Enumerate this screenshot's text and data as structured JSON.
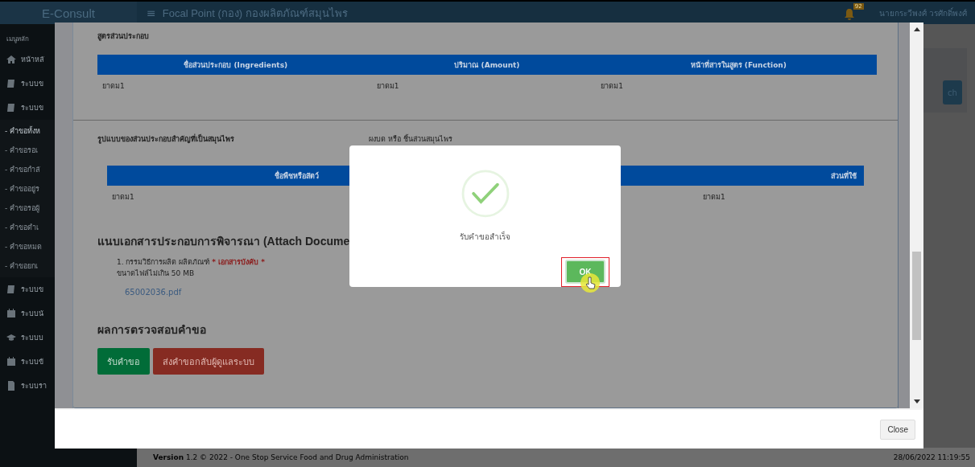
{
  "header": {
    "logo": "E-Consult",
    "menu_icon": "≡",
    "title": "Focal Point (กอง) กองผลิตภัณฑ์สมุนไพร",
    "notification_count": "92",
    "user": "นายกระวีพงศ์ วรศักดิ์พงศ์"
  },
  "sidebar": {
    "heading": "เมนูหลัก",
    "items": [
      {
        "label": "หน้าหลั"
      },
      {
        "label": "ระบบข"
      },
      {
        "label": "ระบบข",
        "children": [
          {
            "label": "- คำขอทั้งห",
            "selected": true
          },
          {
            "label": "- คำขอรอเ",
            "selected": false
          },
          {
            "label": "- คำขอกำลั",
            "selected": false
          },
          {
            "label": "- คำขออยู่ร",
            "selected": false
          },
          {
            "label": "- คำขอรอผู้",
            "selected": false
          },
          {
            "label": "- คำขอดำเ",
            "selected": false
          },
          {
            "label": "- คำขอหมด",
            "selected": false
          },
          {
            "label": "- คำขอยกเ",
            "selected": false
          }
        ]
      },
      {
        "label": "ระบบข"
      },
      {
        "label": "ระบบนั"
      },
      {
        "label": "ระบบบ"
      },
      {
        "label": "ระบบข้"
      },
      {
        "label": "ระบบรา"
      }
    ]
  },
  "main": {
    "search_button": "ch",
    "footer": {
      "version": "**Version** 1.2 © 2022 - One Stop Service Food and Drug Administration",
      "timestamp": "28/06/2022 11:19:55"
    }
  },
  "modal": {
    "formula": {
      "title": "สูตรส่วนประกอบ",
      "columns": [
        "ชื่อส่วนประกอบ (Ingredients)",
        "ปริมาณ (Amount)",
        "หน้าที่สารในสูตร (Function)"
      ],
      "rows": [
        [
          "ยาดม1",
          "ยาดม1",
          "ยาดม1"
        ]
      ]
    },
    "herb_form": {
      "label": "รูปแบบของส่วนประกอบสำคัญที่เป็นสมุนไพร",
      "value": "ผงบด หรือ ชิ้นส่วนสมุนไพร",
      "columns": [
        "ชื่อพืชหรือสัตว์",
        "ส่วนที่ใช้"
      ],
      "rows": [
        [
          "ยาดม1",
          "ยาดม1"
        ]
      ]
    },
    "attachments": {
      "title": "แนบเอกสารประกอบการพิจารณา (Attach Docume",
      "items": [
        {
          "label": "1. กรรมวิธีการผลิต ผลิตภัณฑ์ ",
          "required": "* เอกสารบังคับ *",
          "note": "ขนาดไฟล์ไม่เกิน 50 MB",
          "file": "65002036.pdf"
        }
      ]
    },
    "review": {
      "title": "ผลการตรวจสอบคำขอ",
      "buttons": [
        {
          "label": "รับคำขอ",
          "kind": "accept"
        },
        {
          "label": "ส่งคำขอกลับผู้ดูแลระบบ",
          "kind": "reject"
        }
      ]
    },
    "close_button": "Close"
  },
  "alert": {
    "message": "รับคำขอสำเร็จ",
    "ok_button": "OK",
    "highlighted": true
  }
}
